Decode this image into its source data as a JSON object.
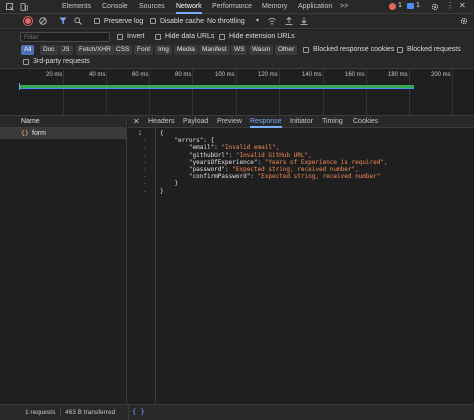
{
  "top_tabs": [
    "Elements",
    "Console",
    "Sources",
    "Network",
    "Performance",
    "Memory",
    "Application"
  ],
  "top_more": ">>",
  "badges": {
    "errors": "1",
    "messages": "1"
  },
  "toolbar": {
    "preserve_log": "Preserve log",
    "disable_cache": "Disable cache",
    "throttling": "No throttling"
  },
  "filter": {
    "placeholder": "Filter",
    "invert": "Invert",
    "hide_data_urls": "Hide data URLs",
    "hide_extension_urls": "Hide extension URLs"
  },
  "type_filters": [
    "All",
    "Doc",
    "JS",
    "Fetch/XHR",
    "CSS",
    "Font",
    "Img",
    "Media",
    "Manifest",
    "WS",
    "Wasm",
    "Other"
  ],
  "blocked_response_cookies": "Blocked response cookies",
  "blocked_requests": "Blocked requests",
  "third_party_requests": "3rd-party requests",
  "timeline_ticks": [
    "20 ms",
    "40 ms",
    "60 ms",
    "80 ms",
    "100 ms",
    "120 ms",
    "140 ms",
    "160 ms",
    "180 ms",
    "200 ms"
  ],
  "request_list": {
    "header": "Name",
    "rows": [
      "form"
    ]
  },
  "detail_tabs": [
    "Headers",
    "Payload",
    "Preview",
    "Response",
    "Initiator",
    "Timing",
    "Cookies"
  ],
  "response_lines": [
    {
      "n": "1",
      "text": "{"
    },
    {
      "n": "-",
      "text": "    \"errors\": {"
    },
    {
      "n": "-",
      "key": "        \"email\": ",
      "val": "\"Invalid email\","
    },
    {
      "n": "-",
      "key": "        \"githubUrl\": ",
      "val": "\"Invalid GitHub URL\","
    },
    {
      "n": "-",
      "key": "        \"yearsOfExperience\": ",
      "val": "\"Years of Experience is required\","
    },
    {
      "n": "-",
      "key": "        \"password\": ",
      "val": "\"Expected string, received number\","
    },
    {
      "n": "-",
      "key": "        \"confirmPassword\": ",
      "val": "\"Expected string, received number\""
    },
    {
      "n": "-",
      "text": "    }"
    },
    {
      "n": "-",
      "text": "}"
    }
  ],
  "status": {
    "requests": "1 requests",
    "transferred": "463 B transferred"
  },
  "colors": {
    "accent": "#7cacf8",
    "string": "#f28b54",
    "waterfall": "#34a853",
    "error": "#e46962"
  }
}
